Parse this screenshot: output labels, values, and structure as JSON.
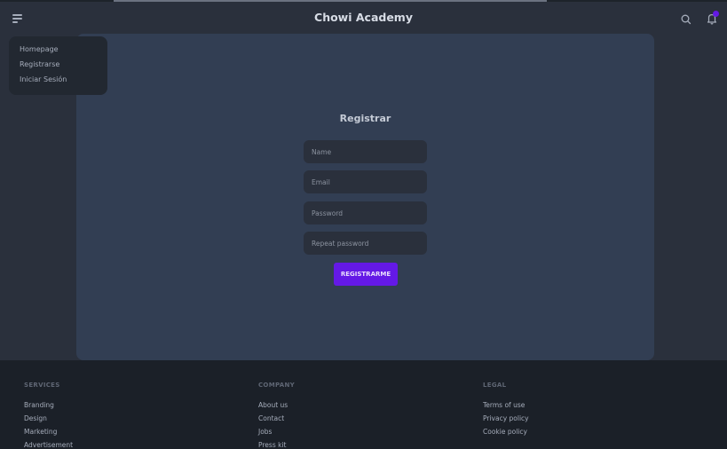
{
  "navbar": {
    "brand": "Chowi Academy",
    "menu_icon": "hamburger-icon",
    "search_icon": "search-icon",
    "bell_icon": "bell-icon"
  },
  "menu": {
    "items": [
      {
        "label": "Homepage"
      },
      {
        "label": "Registrarse"
      },
      {
        "label": "Iniciar Sesión"
      }
    ]
  },
  "form": {
    "title": "Registrar",
    "name_placeholder": "Name",
    "email_placeholder": "Email",
    "password_placeholder": "Password",
    "repeat_password_placeholder": "Repeat password",
    "submit_label": "REGISTRARME"
  },
  "footer": {
    "services": {
      "title": "SERVICES",
      "links": [
        "Branding",
        "Design",
        "Marketing",
        "Advertisement"
      ]
    },
    "company": {
      "title": "COMPANY",
      "links": [
        "About us",
        "Contact",
        "Jobs",
        "Press kit"
      ]
    },
    "legal": {
      "title": "LEGAL",
      "links": [
        "Terms of use",
        "Privacy policy",
        "Cookie policy"
      ]
    }
  },
  "colors": {
    "background": "#2a303c",
    "card": "#323e53",
    "primary": "#6419e6",
    "footer": "#1b2028"
  }
}
